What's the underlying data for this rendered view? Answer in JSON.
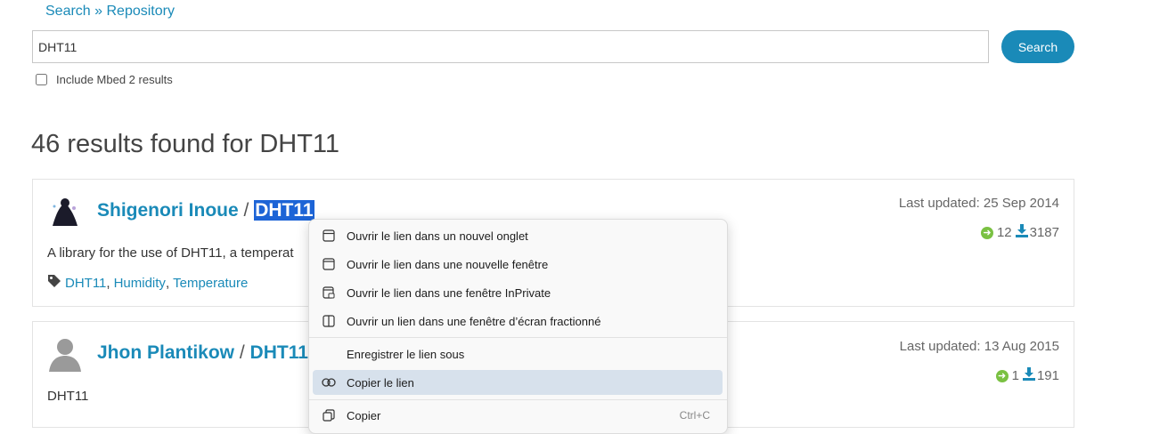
{
  "breadcrumb": "Search » Repository",
  "search": {
    "value": "DHT11",
    "button": "Search"
  },
  "include_mbed2_label": "Include Mbed 2 results",
  "result_count_text": "46 results found for DHT11",
  "results": [
    {
      "author": "Shigenori Inoue",
      "separator": "/",
      "repo": "DHT11",
      "updated_label": "Last updated:",
      "updated_date": "25 Sep 2014",
      "imports": "12",
      "downloads": "3187",
      "description": "A library for the use of DHT11, a temperat",
      "tags": [
        "DHT11",
        "Humidity",
        "Temperature"
      ]
    },
    {
      "author": "Jhon Plantikow",
      "separator": "/",
      "repo": "DHT11",
      "updated_label": "Last updated:",
      "updated_date": "13 Aug 2015",
      "imports": "1",
      "downloads": "191",
      "description": "DHT11"
    }
  ],
  "context_menu": {
    "items": [
      {
        "label": "Ouvrir le lien dans un nouvel onglet",
        "icon": "new-tab-icon"
      },
      {
        "label": "Ouvrir le lien dans une nouvelle fenêtre",
        "icon": "new-window-icon"
      },
      {
        "label": "Ouvrir le lien dans une fenêtre InPrivate",
        "icon": "inprivate-window-icon"
      },
      {
        "label": "Ouvrir un lien dans une fenêtre d’écran fractionné",
        "icon": "split-screen-icon"
      },
      {
        "label": "Enregistrer le lien sous",
        "icon": ""
      },
      {
        "label": "Copier le lien",
        "icon": "link-icon"
      },
      {
        "label": "Copier",
        "icon": "copy-icon",
        "shortcut": "Ctrl+C"
      }
    ]
  },
  "colors": {
    "link": "#1a8ab8",
    "highlight": "#1d64d6",
    "import_green": "#7ac142",
    "menu_hover": "#d7e1ec"
  }
}
